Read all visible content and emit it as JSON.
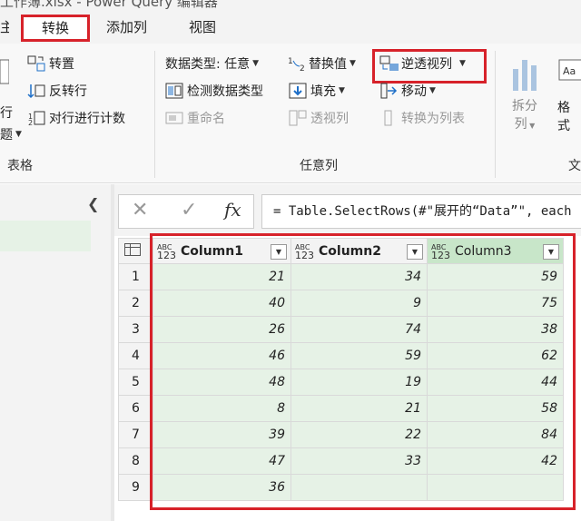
{
  "title": "工作簿.xlsx - Power Query 编辑器",
  "tabs": [
    "主",
    "转换",
    "添加列",
    "视图"
  ],
  "ribbon": {
    "left_fragments": {
      "top": "行",
      "bottom": "题"
    },
    "transpose": "转置",
    "reverse_rows": "反转行",
    "count_rows": "对行进行计数",
    "table_group": "表格",
    "data_type": "数据类型: 任意",
    "detect_type": "检测数据类型",
    "rename": "重命名",
    "replace_values": "替换值",
    "fill": "填充",
    "pivot": "透视列",
    "unpivot": "逆透视列",
    "move": "移动",
    "to_list": "转换为列表",
    "anycol_group": "任意列",
    "split_top": "拆分",
    "split_bottom": "列",
    "format_top": "格",
    "format_bottom": "式",
    "right_group": "文"
  },
  "formula_bar": {
    "cancel": "✕",
    "confirm": "✓",
    "fx": "fx",
    "formula": "= Table.SelectRows(#\"展开的“Data”\", each"
  },
  "table": {
    "columns": [
      {
        "type_top": "ABC",
        "type_bottom": "123",
        "name": "Column1",
        "filtered": true
      },
      {
        "type_top": "ABC",
        "type_bottom": "123",
        "name": "Column2",
        "filtered": false
      },
      {
        "type_top": "ABC",
        "type_bottom": "123",
        "name": "Column3",
        "filtered": false
      }
    ],
    "rows": [
      {
        "n": "1",
        "c1": "21",
        "c2": "34",
        "c3": "59"
      },
      {
        "n": "2",
        "c1": "40",
        "c2": "9",
        "c3": "75"
      },
      {
        "n": "3",
        "c1": "26",
        "c2": "74",
        "c3": "38"
      },
      {
        "n": "4",
        "c1": "46",
        "c2": "59",
        "c3": "62"
      },
      {
        "n": "5",
        "c1": "48",
        "c2": "19",
        "c3": "44"
      },
      {
        "n": "6",
        "c1": "8",
        "c2": "21",
        "c3": "58"
      },
      {
        "n": "7",
        "c1": "39",
        "c2": "22",
        "c3": "84"
      },
      {
        "n": "8",
        "c1": "47",
        "c2": "33",
        "c3": "42"
      },
      {
        "n": "9",
        "c1": "36",
        "c2": "",
        "c3": ""
      }
    ]
  },
  "colors": {
    "highlight": "#d7222a",
    "selected_cell": "#e6f2e6",
    "selected_header": "#c8e6c9"
  }
}
